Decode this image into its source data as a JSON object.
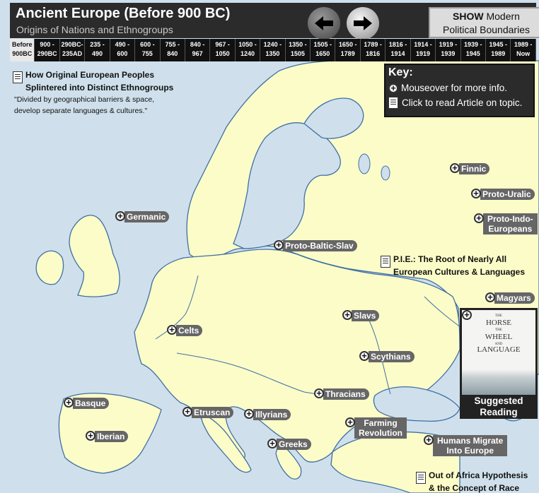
{
  "header": {
    "title": "Ancient Europe (Before 900 BC)",
    "subtitle": "Origins of Nations and Ethnogroups",
    "show_button": {
      "bold": "SHOW",
      "rest": "Modern",
      "line2": "Political Boundaries"
    }
  },
  "timeline": [
    {
      "top": "Before",
      "bottom": "900BC",
      "active": true
    },
    {
      "top": "900 -",
      "bottom": "290BC"
    },
    {
      "top": "290BC-",
      "bottom": "235AD"
    },
    {
      "top": "235 -",
      "bottom": "490"
    },
    {
      "top": "490 -",
      "bottom": "600"
    },
    {
      "top": "600 -",
      "bottom": "755"
    },
    {
      "top": "755 -",
      "bottom": "840"
    },
    {
      "top": "840 -",
      "bottom": "967"
    },
    {
      "top": "967 -",
      "bottom": "1050"
    },
    {
      "top": "1050 -",
      "bottom": "1240"
    },
    {
      "top": "1240 -",
      "bottom": "1350"
    },
    {
      "top": "1350 -",
      "bottom": "1505"
    },
    {
      "top": "1505 -",
      "bottom": "1650"
    },
    {
      "top": "1650 -",
      "bottom": "1789"
    },
    {
      "top": "1789 -",
      "bottom": "1816"
    },
    {
      "top": "1816 -",
      "bottom": "1914"
    },
    {
      "top": "1914 -",
      "bottom": "1919"
    },
    {
      "top": "1919 -",
      "bottom": "1939"
    },
    {
      "top": "1939 -",
      "bottom": "1945"
    },
    {
      "top": "1945 -",
      "bottom": "1989"
    },
    {
      "top": "1989 -",
      "bottom": "Now"
    }
  ],
  "key": {
    "title": "Key:",
    "mouseover": "Mouseover for more info.",
    "click": "Click to read Article on topic."
  },
  "articles": {
    "splintered": {
      "line1": "How Original European Peoples",
      "line2": "Splintered into Distinct Ethnogroups",
      "note1": "\"Divided by geographical barriers & space,",
      "note2": "develop separate languages & cultures.\""
    },
    "pie": {
      "line1": "P.I.E.: The Root of Nearly All",
      "line2": "European Cultures & Languages"
    },
    "africa": {
      "line1": "Out of Africa Hypothesis",
      "line2": "& the Concept of Race"
    }
  },
  "markers": {
    "finnic": "Finnic",
    "proto_uralic": "Proto-Uralic",
    "proto_indo_1": "Proto-Indo-",
    "proto_indo_2": "Europeans",
    "germanic": "Germanic",
    "proto_baltic_slav": "Proto-Baltic-Slav",
    "magyars": "Magyars",
    "slavs": "Slavs",
    "celts": "Celts",
    "scythians": "Scythians",
    "thracians": "Thracians",
    "basque": "Basque",
    "etruscan": "Etruscan",
    "illyrians": "Illyrians",
    "farming_1": "Farming",
    "farming_2": "Revolution",
    "iberian": "Iberian",
    "greeks": "Greeks",
    "humans_1": "Humans Migrate",
    "humans_2": "Into Europe"
  },
  "book": {
    "title1": "THE",
    "title2": "HORSE",
    "title3": "THE",
    "title4": "WHEEL",
    "title5": "AND",
    "title6": "LANGUAGE",
    "label1": "Suggested",
    "label2": "Reading"
  },
  "colors": {
    "land": "#fcfcc8",
    "sea": "#cfe0ec",
    "border": "#3f6fa3",
    "header": "#2b2b2b",
    "pill": "#666666"
  }
}
